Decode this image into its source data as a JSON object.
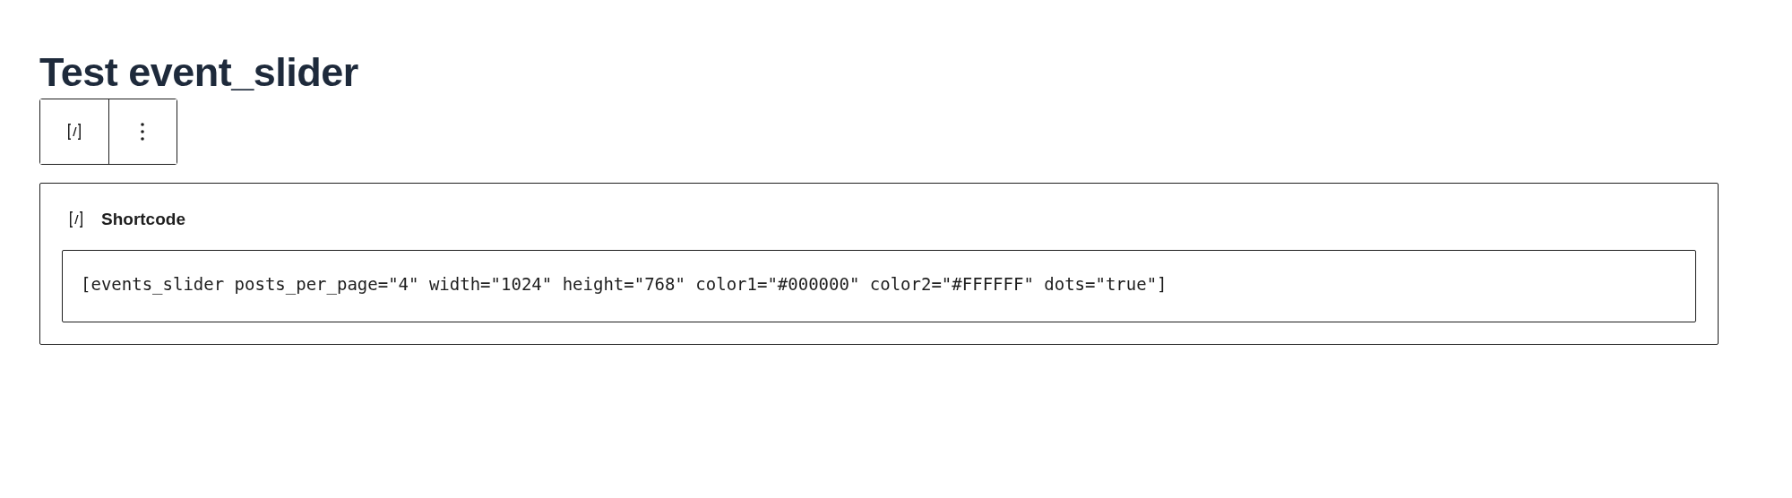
{
  "title": "Test event_slider",
  "block": {
    "label": "Shortcode",
    "value": "[events_slider posts_per_page=\"4\" width=\"1024\" height=\"768\" color1=\"#000000\" color2=\"#FFFFFF\" dots=\"true\"]"
  }
}
